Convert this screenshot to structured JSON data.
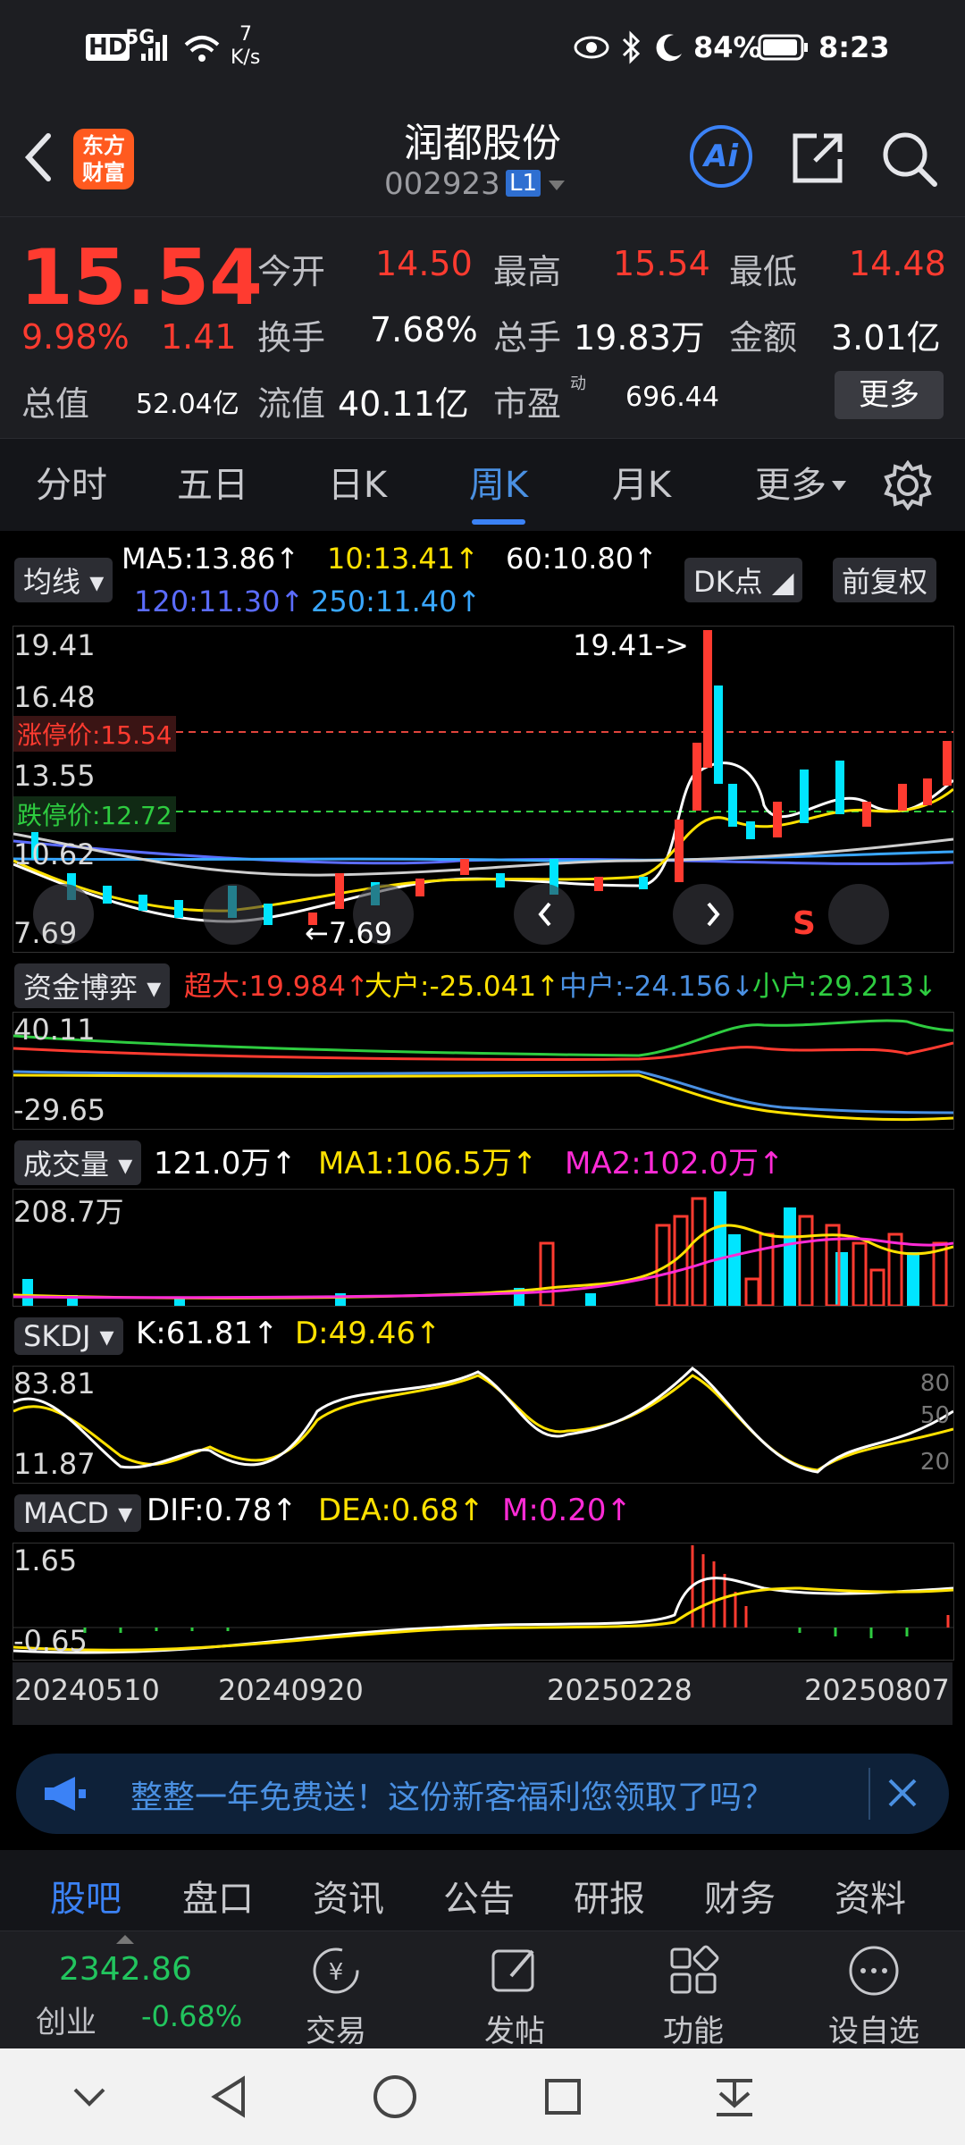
{
  "status_bar": {
    "net_type": "HD",
    "signal": "5G",
    "speed_value": "7",
    "speed_unit": "K/s",
    "battery": "84%",
    "time": "8:23"
  },
  "header": {
    "logo_line1": "东方",
    "logo_line2": "财富",
    "title": "润都股份",
    "code": "002923",
    "level_badge": "L1",
    "ai_label": "Ai"
  },
  "quote": {
    "price": "15.54",
    "change_pct": "9.98%",
    "change": "1.41",
    "open_label": "今开",
    "open": "14.50",
    "high_label": "最高",
    "high": "15.54",
    "low_label": "最低",
    "low": "14.48",
    "turnover_label": "换手",
    "turnover": "7.68%",
    "volume_label": "总手",
    "volume": "19.83万",
    "amount_label": "金额",
    "amount": "3.01亿",
    "mcap_label": "总值",
    "mcap": "52.04亿",
    "float_label": "流值",
    "float": "40.11亿",
    "pe_label": "市盈",
    "pe_sup": "动",
    "pe": "696.44",
    "more_button": "更多"
  },
  "tabs": [
    "分时",
    "五日",
    "日K",
    "周K",
    "月K",
    "更多"
  ],
  "active_tab": "周K",
  "ma_bar": {
    "selector": "均线",
    "ma5": "MA5:13.86↑",
    "ma10": "10:13.41↑",
    "ma60": "60:10.80↑",
    "ma120": "120:11.30↑",
    "ma250": "250:11.40↑",
    "dk_button": "DK点",
    "adjust_button": "前复权"
  },
  "kline": {
    "y_top": "19.41",
    "y_2": "16.48",
    "y_3": "13.55",
    "y_4": "10.62",
    "y_bottom": "7.69",
    "high_marker": "19.41->",
    "low_marker": "←7.69",
    "limit_up": "涨停价:15.54",
    "limit_down": "跌停价:12.72",
    "s_marker": "S"
  },
  "fund": {
    "selector": "资金博弈",
    "super": "超大:19.984↑",
    "big": "大户:-25.041↑",
    "mid": "中户:-24.156↓",
    "small": "小户:29.213↓",
    "y_top": "40.11",
    "y_bottom": "-29.65"
  },
  "vol": {
    "selector": "成交量",
    "value": "121.0万↑",
    "ma1": "MA1:106.5万↑",
    "ma2": "MA2:102.0万↑",
    "y_top": "208.7万"
  },
  "skdj": {
    "selector": "SKDJ",
    "k": "K:61.81↑",
    "d": "D:49.46↑",
    "y_top": "83.81",
    "y_bottom": "11.87",
    "r80": "80",
    "r50": "50",
    "r20": "20"
  },
  "macd": {
    "selector": "MACD",
    "dif": "DIF:0.78↑",
    "dea": "DEA:0.68↑",
    "m": "M:0.20↑",
    "y_top": "1.65",
    "y_bottom": "-0.65"
  },
  "x_axis": [
    "20240510",
    "20240920",
    "20250228",
    "20250807"
  ],
  "banner": {
    "text": "整整一年免费送！这份新客福利您领取了吗？"
  },
  "bottom_tabs": [
    "股吧",
    "盘口",
    "资讯",
    "公告",
    "研报",
    "财务",
    "资料"
  ],
  "toolbar": {
    "index_value": "2342.86",
    "index_name": "创业",
    "index_change": "-0.68%",
    "trade": "交易",
    "post": "发帖",
    "func": "功能",
    "watch": "设自选"
  },
  "colors": {
    "up": "#ff3b30",
    "down": "#22c55e",
    "cyan": "#00e5ff",
    "yellow": "#ffe100",
    "magenta": "#ff2bd6",
    "accent": "#3b82f6"
  }
}
